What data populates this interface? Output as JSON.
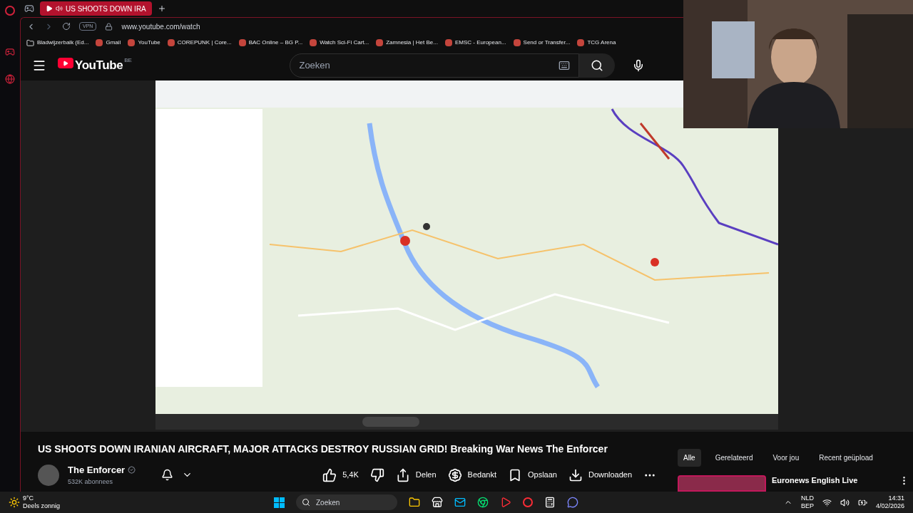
{
  "browser": {
    "tabs": [
      {
        "label": "US SHOOTS DOWN IRA",
        "selected": true,
        "muted": false
      }
    ],
    "address": "www.youtube.com/watch",
    "vpn": "VPN",
    "bookmarks": [
      {
        "label": "Bladwijzerbalk (Ed..."
      },
      {
        "label": "Gmail"
      },
      {
        "label": "YouTube"
      },
      {
        "label": "COREPUNK | Core..."
      },
      {
        "label": "BAC Online – BG P..."
      },
      {
        "label": "Watch Sci-Fi Cart..."
      },
      {
        "label": "Zamnesia | Het Be..."
      },
      {
        "label": "EMSC - European..."
      },
      {
        "label": "Send or Transfer..."
      },
      {
        "label": "TCG Arena"
      }
    ]
  },
  "youtube": {
    "logo": "YouTube",
    "country": "BE",
    "search": {
      "placeholder": "Zoeken"
    },
    "video": {
      "title": "US SHOOTS DOWN IRANIAN AIRCRAFT, MAJOR ATTACKS DESTROY RUSSIAN GRID! Breaking War News The Enforcer"
    },
    "channel": {
      "name": "The Enforcer",
      "verified": true,
      "subscribers": "532K abonnees"
    },
    "actions": [
      {
        "kind": "like",
        "label": "5,4K"
      },
      {
        "kind": "share",
        "label": "Delen"
      },
      {
        "kind": "thanks",
        "label": "Bedankt"
      },
      {
        "kind": "save",
        "label": "Opslaan"
      },
      {
        "kind": "download",
        "label": "Downloaden"
      }
    ],
    "chips": [
      {
        "label": "Alle",
        "selected": true
      },
      {
        "label": "Gerelateerd",
        "selected": false
      },
      {
        "label": "Voor jou",
        "selected": false
      },
      {
        "label": "Recent geüpload",
        "selected": false
      }
    ],
    "related": [
      {
        "title": "Euronews English Live"
      }
    ]
  },
  "taskbar": {
    "weather": {
      "temp": "9°C",
      "desc": "Deels zonnig"
    },
    "search": {
      "placeholder": "Zoeken"
    },
    "language": "NLD",
    "layout": "BEP",
    "time": "14:31",
    "date": "4/02/2026"
  }
}
